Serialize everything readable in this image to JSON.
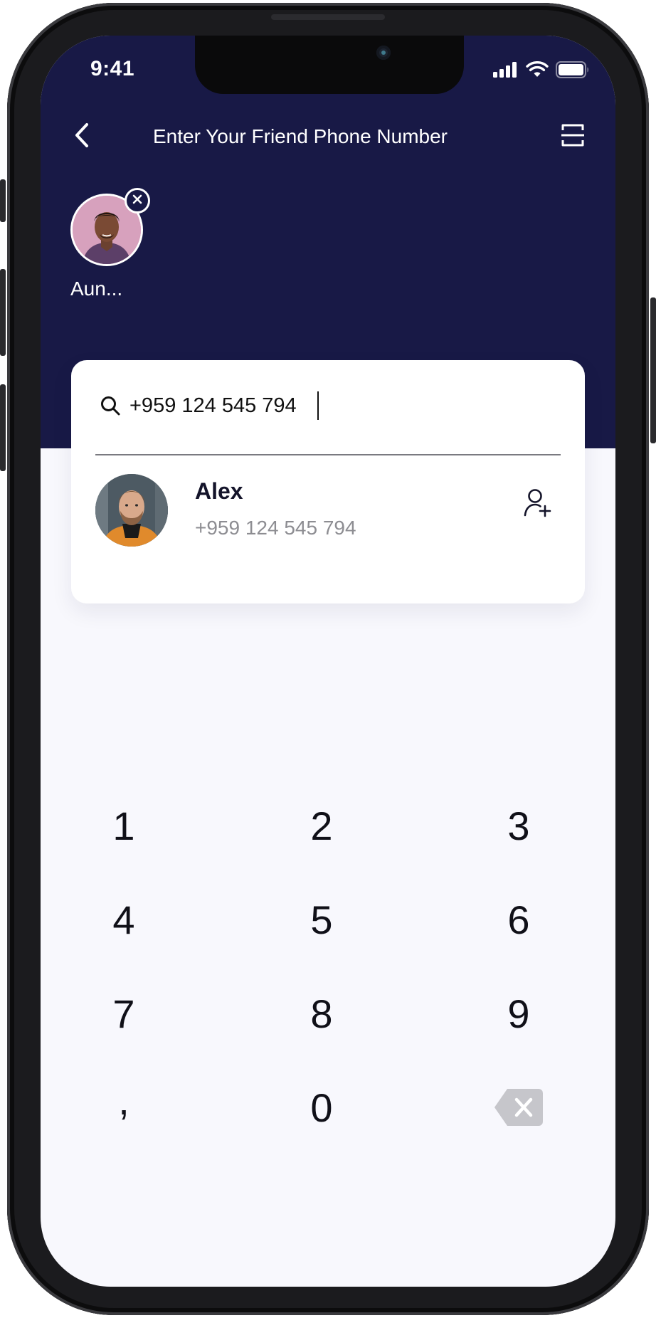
{
  "status_bar": {
    "time": "9:41"
  },
  "nav": {
    "title": "Enter Your Friend Phone Number",
    "back_icon": "chevron-left-icon",
    "menu_icon": "scan-icon"
  },
  "selected_contacts": [
    {
      "label": "Aun...",
      "remove_icon": "close-icon"
    }
  ],
  "search": {
    "value": "+959 124 545 794",
    "placeholder": "",
    "icon": "search-icon"
  },
  "results": [
    {
      "name": "Alex",
      "phone": "+959 124 545 794",
      "action_icon": "add-user-icon"
    }
  ],
  "keypad": {
    "keys": [
      "1",
      "2",
      "3",
      "4",
      "5",
      "6",
      "7",
      "8",
      "9",
      ",",
      "0"
    ],
    "backspace_icon": "backspace-icon"
  },
  "colors": {
    "header": "#181946",
    "screen_bg": "#f8f8fd",
    "card_bg": "#ffffff",
    "secondary_text": "#8d8d92",
    "key_text": "#101018"
  }
}
